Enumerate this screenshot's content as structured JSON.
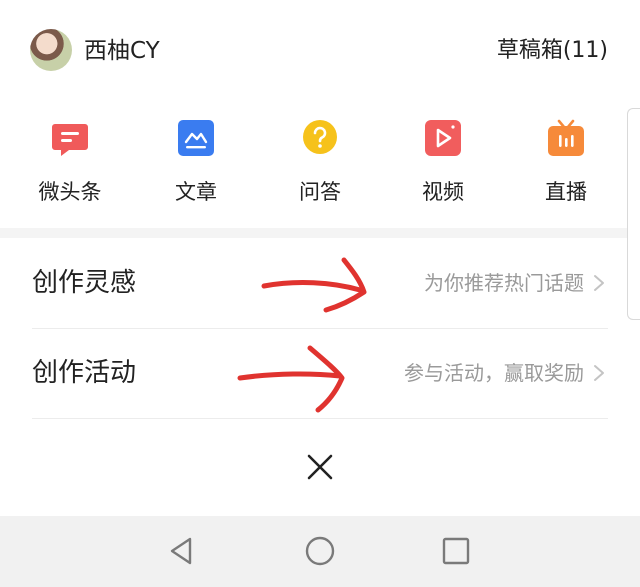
{
  "header": {
    "username": "西柚CY",
    "drafts_label": "草稿箱(11)"
  },
  "actions": [
    {
      "label": "微头条",
      "icon": "micro-post-icon",
      "color": "#f05a5a"
    },
    {
      "label": "文章",
      "icon": "article-icon",
      "color": "#3a7cf0"
    },
    {
      "label": "问答",
      "icon": "qa-icon",
      "color": "#f6c21b"
    },
    {
      "label": "视频",
      "icon": "video-icon",
      "color": "#f15d5d"
    },
    {
      "label": "直播",
      "icon": "live-icon",
      "color": "#f68a3a"
    }
  ],
  "menu": [
    {
      "title": "创作灵感",
      "subtitle": "为你推荐热门话题"
    },
    {
      "title": "创作活动",
      "subtitle": "参与活动，赢取奖励"
    }
  ],
  "colors": {
    "annotation": "#e0332f",
    "band": "#f4f4f4",
    "navbar": "#f1f1f1",
    "muted_text": "#9a9a9a"
  },
  "icons": {
    "close": "close-icon",
    "nav_back": "back-triangle-icon",
    "nav_home": "home-circle-icon",
    "nav_recents": "recents-square-icon",
    "chevron": "chevron-right-icon"
  }
}
